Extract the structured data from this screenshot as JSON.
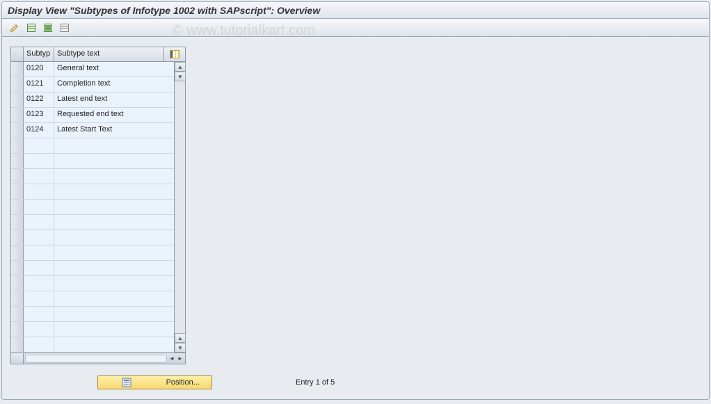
{
  "title": "Display View \"Subtypes of Infotype 1002 with SAPscript\": Overview",
  "watermark": "© www.tutorialkart.com",
  "columns": {
    "subtyp": "Subtyp",
    "text": "Subtype text"
  },
  "rows": [
    {
      "subtyp": "0120",
      "text": "General text"
    },
    {
      "subtyp": "0121",
      "text": "Completion text"
    },
    {
      "subtyp": "0122",
      "text": "Latest end text"
    },
    {
      "subtyp": "0123",
      "text": "Requested end text"
    },
    {
      "subtyp": "0124",
      "text": "Latest Start Text"
    }
  ],
  "empty_rows": 14,
  "position_button": "Position...",
  "entry_status": "Entry 1 of 5"
}
